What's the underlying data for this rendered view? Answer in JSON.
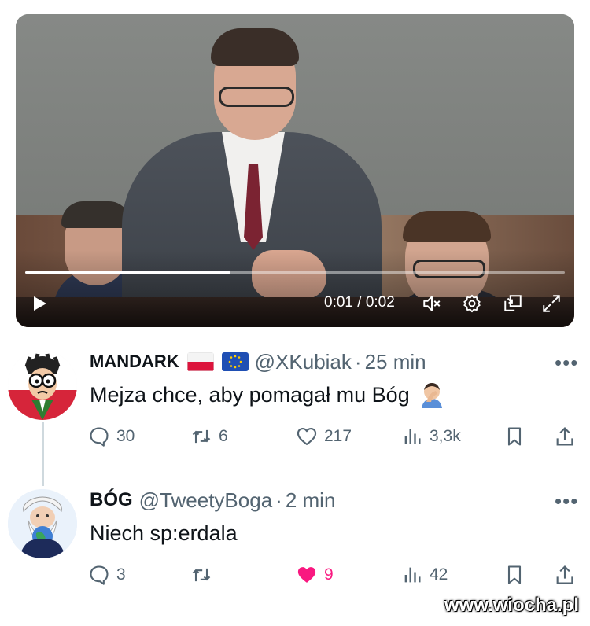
{
  "video": {
    "time": "0:01 / 0:02",
    "progress_fraction": 0.38,
    "icons": [
      "play-icon",
      "mute-icon",
      "settings-icon",
      "dock-icon",
      "fullscreen-icon"
    ]
  },
  "tweets": [
    {
      "name": "MANDARK",
      "flags": [
        "poland-flag",
        "eu-flag"
      ],
      "handle": "@XKubiak",
      "separator": "·",
      "age": "25 min",
      "more": "•••",
      "text": "Mejza chce, aby pomagał mu Bóg",
      "emoji": "facepalm-emoji",
      "replies": "30",
      "reposts": "6",
      "likes": "217",
      "views": "3,3k",
      "liked": false
    },
    {
      "name": "BÓG",
      "handle": "@TweetyBoga",
      "separator": "·",
      "age": "2 min",
      "more": "•••",
      "text": "Niech sp:erdala",
      "replies": "3",
      "reposts": "",
      "likes": "9",
      "views": "42",
      "liked": true
    }
  ],
  "colors": {
    "like_active": "#f91880",
    "secondary_text": "#536471"
  },
  "watermark": "www.wiocha.pl"
}
